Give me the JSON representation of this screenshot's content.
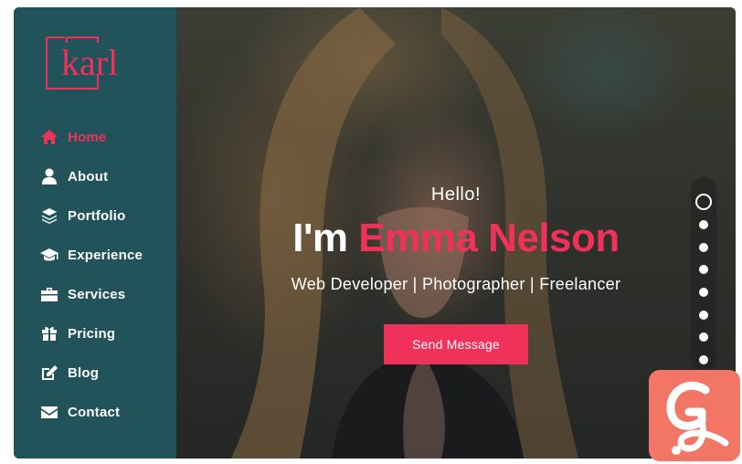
{
  "logo": {
    "text": "karl",
    "color": "#f0315a"
  },
  "sidebar": {
    "background": "#22535a",
    "items": [
      {
        "label": "Home",
        "icon": "home-icon",
        "active": true
      },
      {
        "label": "About",
        "icon": "user-icon",
        "active": false
      },
      {
        "label": "Portfolio",
        "icon": "layers-icon",
        "active": false
      },
      {
        "label": "Experience",
        "icon": "graduation-cap-icon",
        "active": false
      },
      {
        "label": "Services",
        "icon": "briefcase-icon",
        "active": false
      },
      {
        "label": "Pricing",
        "icon": "gift-icon",
        "active": false
      },
      {
        "label": "Blog",
        "icon": "edit-icon",
        "active": false
      },
      {
        "label": "Contact",
        "icon": "envelope-icon",
        "active": false
      }
    ]
  },
  "hero": {
    "greeting": "Hello!",
    "intro": "I'm",
    "name": "Emma Nelson",
    "roles": "Web Developer | Photographer | Freelancer",
    "button_label": "Send Message",
    "accent": "#f0315a"
  },
  "pager": {
    "count": 8,
    "current": 1
  },
  "badge": {
    "icon": "brand-g-icon",
    "color": "#f37565"
  }
}
